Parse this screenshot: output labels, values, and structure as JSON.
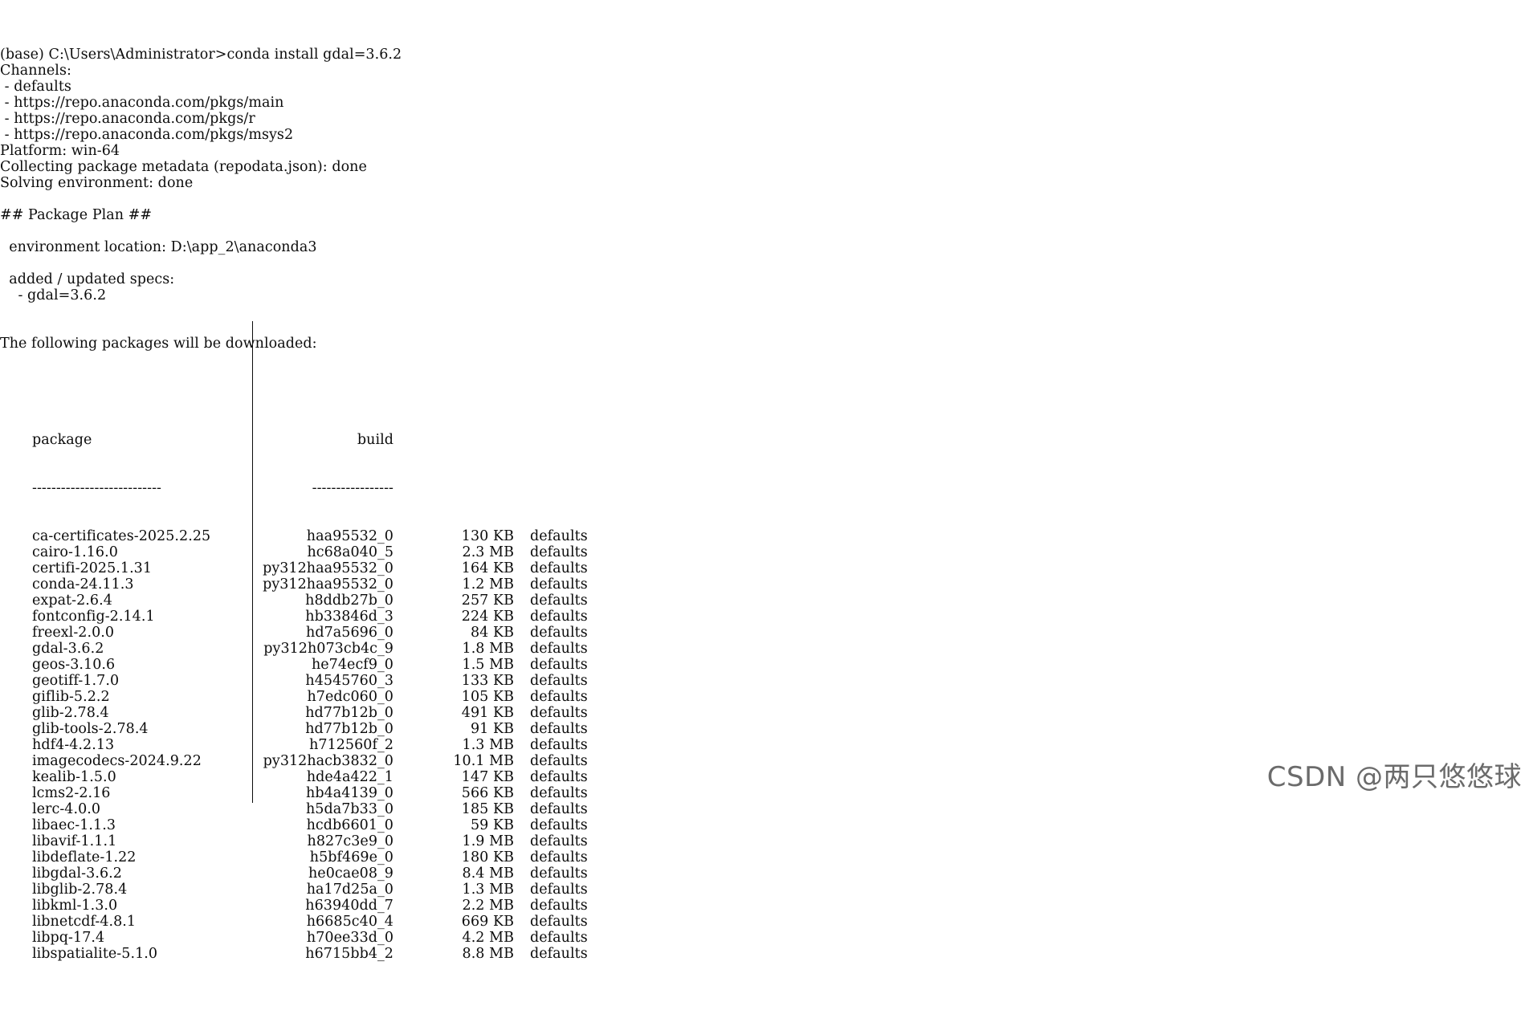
{
  "terminal": {
    "header_lines": [
      "(base) C:\\Users\\Administrator>conda install gdal=3.6.2",
      "Channels:",
      " - defaults",
      " - https://repo.anaconda.com/pkgs/main",
      " - https://repo.anaconda.com/pkgs/r",
      " - https://repo.anaconda.com/pkgs/msys2",
      "Platform: win-64",
      "Collecting package metadata (repodata.json): done",
      "Solving environment: done",
      "",
      "## Package Plan ##",
      "",
      "  environment location: D:\\app_2\\anaconda3",
      "",
      "  added / updated specs:",
      "    - gdal=3.6.2",
      "",
      "",
      "The following packages will be downloaded:",
      ""
    ],
    "table": {
      "header_package": "package",
      "header_build": "build",
      "divider_package": "---------------------------",
      "divider_build": "-----------------",
      "rows": [
        {
          "package": "ca-certificates-2025.2.25",
          "build": "haa95532_0",
          "size": "130 KB",
          "channel": "defaults"
        },
        {
          "package": "cairo-1.16.0",
          "build": "hc68a040_5",
          "size": "2.3 MB",
          "channel": "defaults"
        },
        {
          "package": "certifi-2025.1.31",
          "build": "py312haa95532_0",
          "size": "164 KB",
          "channel": "defaults"
        },
        {
          "package": "conda-24.11.3",
          "build": "py312haa95532_0",
          "size": "1.2 MB",
          "channel": "defaults"
        },
        {
          "package": "expat-2.6.4",
          "build": "h8ddb27b_0",
          "size": "257 KB",
          "channel": "defaults"
        },
        {
          "package": "fontconfig-2.14.1",
          "build": "hb33846d_3",
          "size": "224 KB",
          "channel": "defaults"
        },
        {
          "package": "freexl-2.0.0",
          "build": "hd7a5696_0",
          "size": "84 KB",
          "channel": "defaults"
        },
        {
          "package": "gdal-3.6.2",
          "build": "py312h073cb4c_9",
          "size": "1.8 MB",
          "channel": "defaults"
        },
        {
          "package": "geos-3.10.6",
          "build": "he74ecf9_0",
          "size": "1.5 MB",
          "channel": "defaults"
        },
        {
          "package": "geotiff-1.7.0",
          "build": "h4545760_3",
          "size": "133 KB",
          "channel": "defaults"
        },
        {
          "package": "giflib-5.2.2",
          "build": "h7edc060_0",
          "size": "105 KB",
          "channel": "defaults"
        },
        {
          "package": "glib-2.78.4",
          "build": "hd77b12b_0",
          "size": "491 KB",
          "channel": "defaults"
        },
        {
          "package": "glib-tools-2.78.4",
          "build": "hd77b12b_0",
          "size": "91 KB",
          "channel": "defaults"
        },
        {
          "package": "hdf4-4.2.13",
          "build": "h712560f_2",
          "size": "1.3 MB",
          "channel": "defaults"
        },
        {
          "package": "imagecodecs-2024.9.22",
          "build": "py312hacb3832_0",
          "size": "10.1 MB",
          "channel": "defaults"
        },
        {
          "package": "kealib-1.5.0",
          "build": "hde4a422_1",
          "size": "147 KB",
          "channel": "defaults"
        },
        {
          "package": "lcms2-2.16",
          "build": "hb4a4139_0",
          "size": "566 KB",
          "channel": "defaults"
        },
        {
          "package": "lerc-4.0.0",
          "build": "h5da7b33_0",
          "size": "185 KB",
          "channel": "defaults"
        },
        {
          "package": "libaec-1.1.3",
          "build": "hcdb6601_0",
          "size": "59 KB",
          "channel": "defaults"
        },
        {
          "package": "libavif-1.1.1",
          "build": "h827c3e9_0",
          "size": "1.9 MB",
          "channel": "defaults"
        },
        {
          "package": "libdeflate-1.22",
          "build": "h5bf469e_0",
          "size": "180 KB",
          "channel": "defaults"
        },
        {
          "package": "libgdal-3.6.2",
          "build": "he0cae08_9",
          "size": "8.4 MB",
          "channel": "defaults"
        },
        {
          "package": "libglib-2.78.4",
          "build": "ha17d25a_0",
          "size": "1.3 MB",
          "channel": "defaults"
        },
        {
          "package": "libkml-1.3.0",
          "build": "h63940dd_7",
          "size": "2.2 MB",
          "channel": "defaults"
        },
        {
          "package": "libnetcdf-4.8.1",
          "build": "h6685c40_4",
          "size": "669 KB",
          "channel": "defaults"
        },
        {
          "package": "libpq-17.4",
          "build": "h70ee33d_0",
          "size": "4.2 MB",
          "channel": "defaults"
        },
        {
          "package": "libspatialite-5.1.0",
          "build": "h6715bb4_2",
          "size": "8.8 MB",
          "channel": "defaults"
        }
      ]
    }
  },
  "watermark": "CSDN @两只悠悠球"
}
